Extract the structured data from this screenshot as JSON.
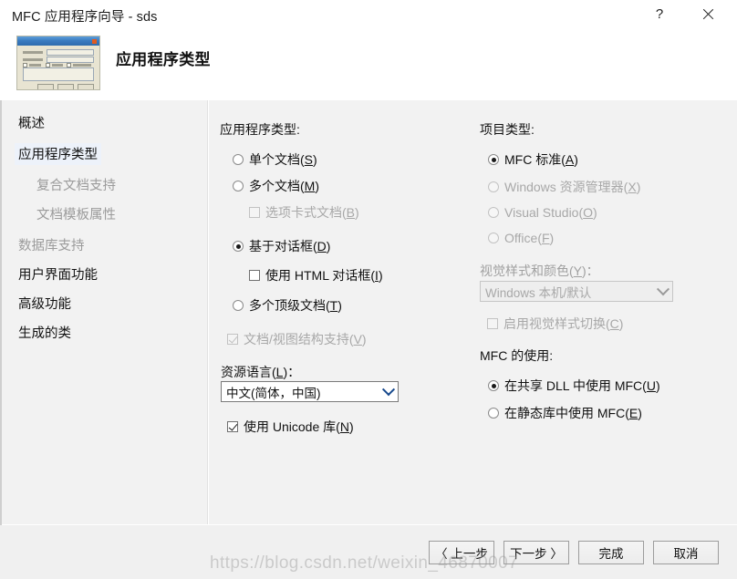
{
  "window": {
    "title": "MFC 应用程序向导 - sds",
    "help_glyph": "?",
    "close_glyph": "close-x"
  },
  "banner": {
    "heading": "应用程序类型"
  },
  "sidebar": {
    "items": [
      {
        "label": "概述",
        "state": "normal",
        "indent": 0
      },
      {
        "label": "应用程序类型",
        "state": "selected",
        "indent": 0
      },
      {
        "label": "复合文档支持",
        "state": "disabled",
        "indent": 1
      },
      {
        "label": "文档模板属性",
        "state": "disabled",
        "indent": 1
      },
      {
        "label": "数据库支持",
        "state": "disabled",
        "indent": 0
      },
      {
        "label": "用户界面功能",
        "state": "normal",
        "indent": 0
      },
      {
        "label": "高级功能",
        "state": "normal",
        "indent": 0
      },
      {
        "label": "生成的类",
        "state": "normal",
        "indent": 0
      }
    ]
  },
  "left_column": {
    "app_type_label": "应用程序类型:",
    "options": [
      {
        "label": "单个文档",
        "accel": "S",
        "type": "radio",
        "checked": false,
        "disabled": false
      },
      {
        "label": "多个文档",
        "accel": "M",
        "type": "radio",
        "checked": false,
        "disabled": false
      },
      {
        "label": "选项卡式文档",
        "accel": "B",
        "type": "checkbox",
        "checked": false,
        "disabled": true
      },
      {
        "label": "基于对话框",
        "accel": "D",
        "type": "radio",
        "checked": true,
        "disabled": false
      },
      {
        "label": "使用 HTML 对话框",
        "accel": "I",
        "type": "checkbox",
        "checked": false,
        "disabled": false
      },
      {
        "label": "多个顶级文档",
        "accel": "T",
        "type": "radio",
        "checked": false,
        "disabled": false
      }
    ],
    "doc_view_support": {
      "label": "文档/视图结构支持",
      "accel": "V",
      "checked": true,
      "disabled": true
    },
    "resource_language_label": "资源语言(L):",
    "resource_language_accel": "L",
    "resource_language_value": "中文(简体，中国)",
    "use_unicode": {
      "label": "使用 Unicode 库",
      "accel": "N",
      "checked": true,
      "disabled": false
    }
  },
  "right_column": {
    "project_type_label": "项目类型:",
    "project_types": [
      {
        "label": "MFC 标准",
        "accel": "A",
        "checked": true,
        "disabled": false
      },
      {
        "label": "Windows 资源管理器",
        "accel": "X",
        "checked": false,
        "disabled": true
      },
      {
        "label": "Visual Studio",
        "accel": "O",
        "checked": false,
        "disabled": true
      },
      {
        "label": "Office",
        "accel": "F",
        "checked": false,
        "disabled": true
      }
    ],
    "visual_style_label": "视觉样式和颜色(Y):",
    "visual_style_value": "Windows 本机/默认",
    "visual_style_disabled": true,
    "enable_style_switch": {
      "label": "启用视觉样式切换",
      "accel": "C",
      "checked": false,
      "disabled": true
    },
    "mfc_usage_label": "MFC 的使用:",
    "mfc_usage_options": [
      {
        "label": "在共享 DLL 中使用 MFC",
        "accel": "U",
        "checked": true,
        "disabled": false
      },
      {
        "label": "在静态库中使用 MFC",
        "accel": "E",
        "checked": false,
        "disabled": false
      }
    ]
  },
  "footer": {
    "back": "〈 上一步",
    "next": "下一步 〉",
    "finish": "完成",
    "cancel": "取消"
  },
  "watermark": "https://blog.csdn.net/weixin_46870007"
}
